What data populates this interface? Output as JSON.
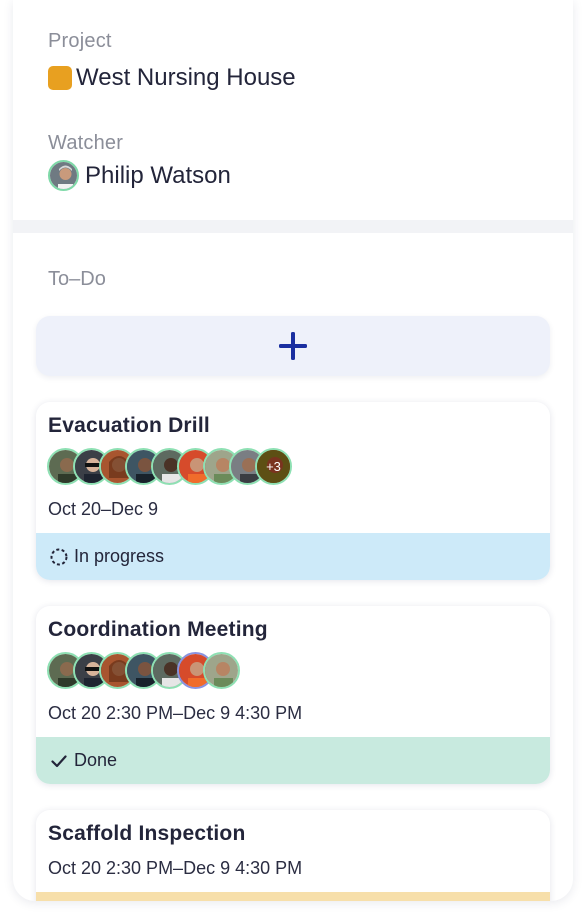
{
  "project": {
    "label": "Project",
    "name": "West Nursing House",
    "color": "#e8a020"
  },
  "watcher": {
    "label": "Watcher",
    "name": "Philip Watson"
  },
  "todo": {
    "label": "To–Do",
    "add_icon": "plus-icon",
    "tasks": [
      {
        "title": "Evacuation Drill",
        "date": "Oct 20–Dec 9",
        "more_count": "+3",
        "status": "In progress",
        "status_icon": "progress-spinner-icon",
        "status_color": "#cdeaf9"
      },
      {
        "title": "Coordination Meeting",
        "date": "Oct 20 2:30 PM–Dec 9 4:30 PM",
        "status": "Done",
        "status_icon": "check-icon",
        "status_color": "#c8eadf"
      },
      {
        "title": "Scaffold Inspection",
        "date": "Oct 20 2:30 PM–Dec 9 4:30 PM",
        "status_color": "#f7dfaa"
      }
    ]
  }
}
